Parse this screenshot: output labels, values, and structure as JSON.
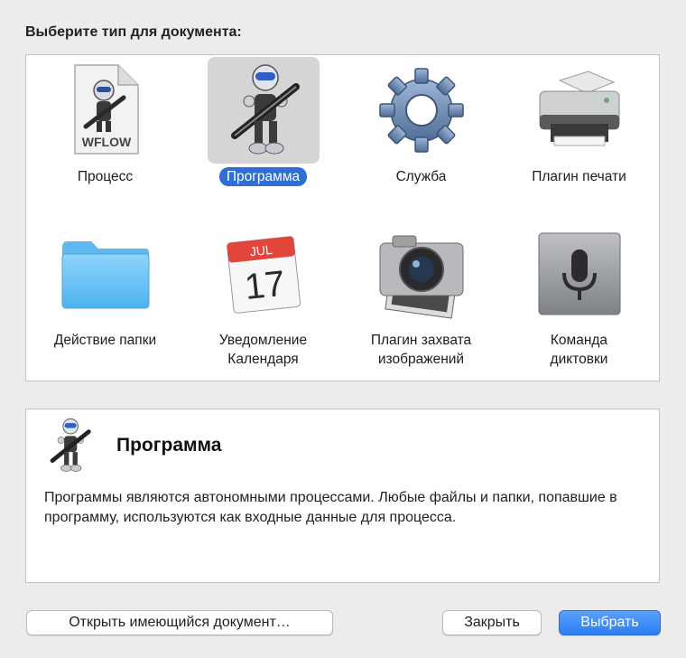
{
  "dialog": {
    "heading": "Выберите тип для документа:"
  },
  "types": [
    {
      "label": "Процесс",
      "badge": "WFLOW",
      "icon": "workflow-document-icon",
      "selected": false
    },
    {
      "label": "Программа",
      "icon": "automator-robot-icon",
      "selected": true
    },
    {
      "label": "Служба",
      "icon": "gear-icon",
      "selected": false
    },
    {
      "label": "Плагин печати",
      "icon": "printer-icon",
      "selected": false
    },
    {
      "label": "Действие папки",
      "icon": "folder-icon",
      "selected": false
    },
    {
      "label": "Уведомление Календаря",
      "line1": "Уведомление",
      "line2": "Календаря",
      "icon": "calendar-icon",
      "cal_month": "JUL",
      "cal_day": "17",
      "selected": false
    },
    {
      "label": "Плагин захвата изображений",
      "line1": "Плагин захвата",
      "line2": "изображений",
      "icon": "camera-icon",
      "selected": false
    },
    {
      "label": "Команда диктовки",
      "line1": "Команда",
      "line2": "диктовки",
      "icon": "microphone-icon",
      "selected": false
    }
  ],
  "description": {
    "title": "Программа",
    "text": "Программы являются автономными процессами. Любые файлы и папки, попавшие в программу, используются как входные данные для процесса.",
    "icon": "automator-robot-icon"
  },
  "buttons": {
    "open_existing": "Открыть имеющийся документ…",
    "close": "Закрыть",
    "choose": "Выбрать"
  },
  "colors": {
    "selection": "#2f6ed3",
    "primary_button": "#3b86f5"
  }
}
